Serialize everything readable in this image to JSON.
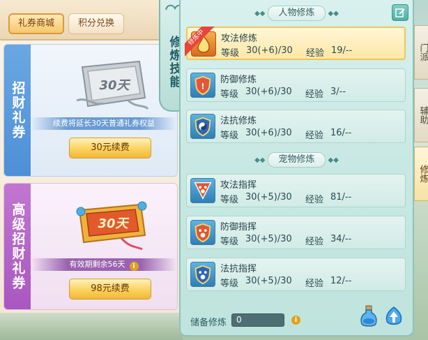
{
  "shop": {
    "tabs": [
      {
        "label": "礼券商城",
        "active": true
      },
      {
        "label": "积分兑换",
        "active": false
      }
    ],
    "cards": [
      {
        "side_label": "招财礼券",
        "ticket_text": "30天",
        "description": "续费将延长30天普通礼券权益",
        "button_label": "30元续费",
        "theme": "#5b9be0"
      },
      {
        "side_label": "高级招财礼券",
        "ticket_text": "30天",
        "description": "有效期剩余56天",
        "button_label": "98元续费",
        "theme": "#b062c6"
      }
    ]
  },
  "skill_tab": {
    "label": "修炼技能"
  },
  "cultivation": {
    "person_title": "人物修炼",
    "pet_title": "宠物修炼",
    "level_label": "等级",
    "exp_label": "经验",
    "cultivating_badge": "修炼中",
    "person_skills": [
      {
        "name": "攻法修炼",
        "level": "30(+6)/30",
        "exp": "19/--",
        "selected": true,
        "icon": "fire-icon"
      },
      {
        "name": "防御修炼",
        "level": "30(+6)/30",
        "exp": "3/--",
        "selected": false,
        "icon": "shield-icon"
      },
      {
        "name": "法抗修炼",
        "level": "30(+6)/30",
        "exp": "16/--",
        "selected": false,
        "icon": "taiji-shield-icon"
      }
    ],
    "pet_skills": [
      {
        "name": "攻法指挥",
        "level": "30(+5)/30",
        "exp": "81/--",
        "icon": "paw-attack-icon"
      },
      {
        "name": "防御指挥",
        "level": "30(+5)/30",
        "exp": "34/--",
        "icon": "paw-defense-icon"
      },
      {
        "name": "法抗指挥",
        "level": "30(+5)/30",
        "exp": "12/--",
        "icon": "paw-resist-icon"
      }
    ],
    "reserve_label": "储备修炼",
    "reserve_value": "0"
  },
  "side_tabs": [
    "门派",
    "辅助",
    "修炼"
  ],
  "colors": {
    "panel_teal": "#c8e8e3",
    "selected_gold": "#fde7a6",
    "button_gold": "#f9cf57"
  }
}
